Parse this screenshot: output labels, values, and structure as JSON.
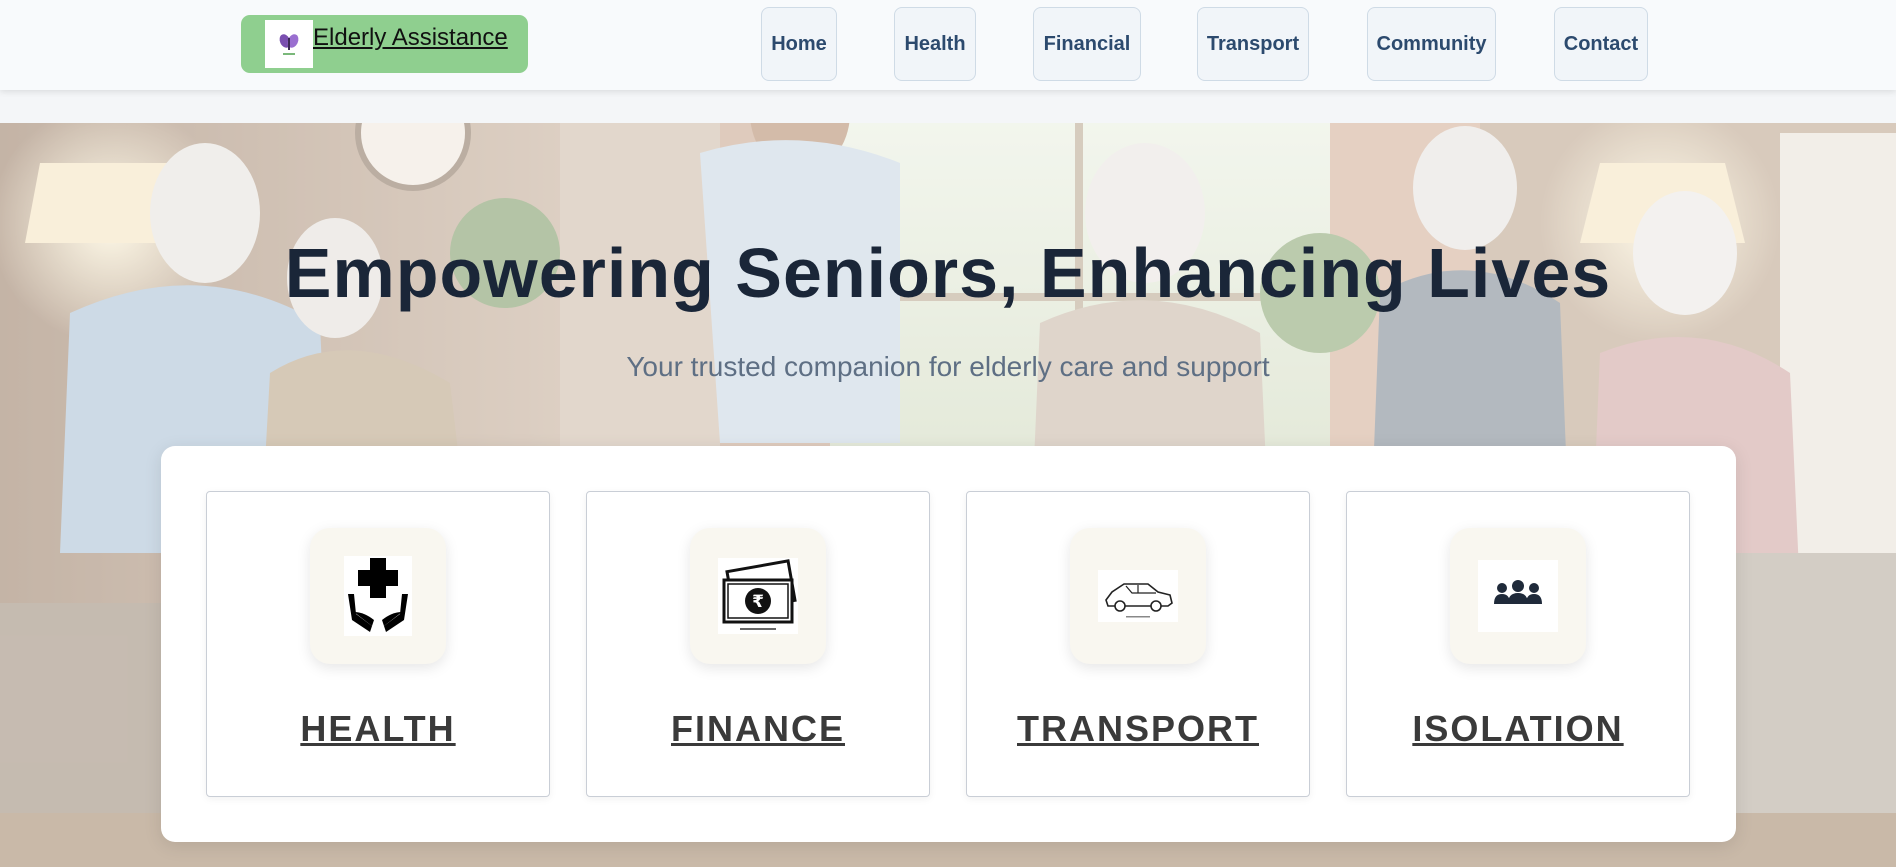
{
  "brand": {
    "name": "Elderly Assistance",
    "logo_icon": "butterfly-logo-icon"
  },
  "nav": {
    "items": [
      {
        "label": "Home"
      },
      {
        "label": "Health"
      },
      {
        "label": "Financial"
      },
      {
        "label": "Transport"
      },
      {
        "label": "Community"
      },
      {
        "label": "Contact"
      }
    ]
  },
  "hero": {
    "title": "Empowering Seniors, Enhancing Lives",
    "subtitle": "Your trusted companion for elderly care and support",
    "background_image": "seniors-living-room-photo"
  },
  "cards": [
    {
      "label": "HEALTH",
      "icon": "medical-cross-hands-icon"
    },
    {
      "label": "FINANCE",
      "icon": "rupee-banknotes-icon"
    },
    {
      "label": "TRANSPORT",
      "icon": "car-icon"
    },
    {
      "label": "ISOLATION",
      "icon": "community-group-icon"
    }
  ],
  "colors": {
    "brand_bg": "#8fcf8f",
    "nav_text": "#2c4a6e",
    "title_text": "#1a2638",
    "subtitle_text": "#5e6f84",
    "card_label": "#3a3a3a"
  }
}
